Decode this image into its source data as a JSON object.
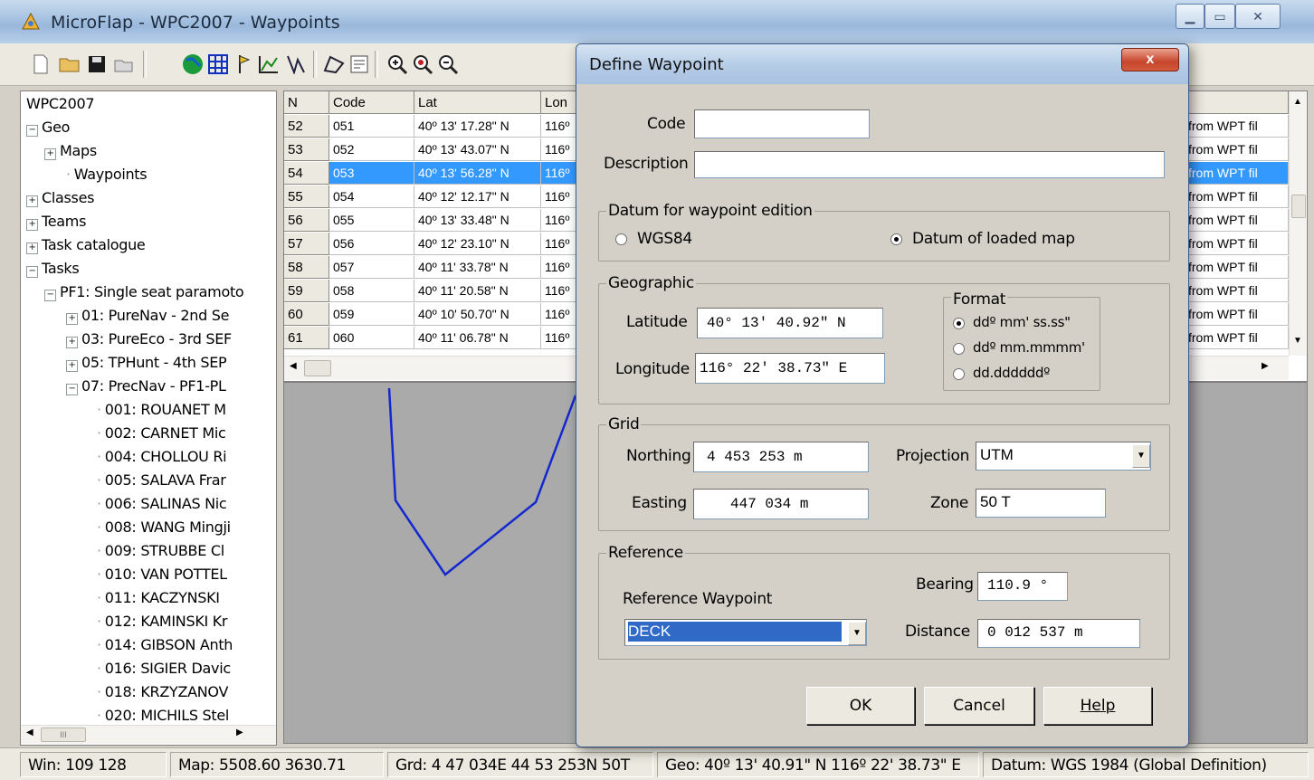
{
  "window": {
    "title": "MicroFlap - WPC2007 - Waypoints"
  },
  "tree": {
    "items": [
      {
        "label": "WPC2007",
        "level": 0,
        "expander": ""
      },
      {
        "label": "Geo",
        "level": 0,
        "expander": "−"
      },
      {
        "label": "Maps",
        "level": 1,
        "expander": "+"
      },
      {
        "label": "Waypoints",
        "level": 2,
        "expander": ""
      },
      {
        "label": "Classes",
        "level": 0,
        "expander": "+"
      },
      {
        "label": "Teams",
        "level": 0,
        "expander": "+"
      },
      {
        "label": "Task catalogue",
        "level": 0,
        "expander": "+"
      },
      {
        "label": "Tasks",
        "level": 0,
        "expander": "−"
      },
      {
        "label": "PF1: Single seat paramoto",
        "level": 1,
        "expander": "−"
      },
      {
        "label": "01: PureNav - 2nd Se",
        "level": 2,
        "expander": "+"
      },
      {
        "label": "03: PureEco - 3rd SEF",
        "level": 2,
        "expander": "+"
      },
      {
        "label": "05: TPHunt - 4th SEP",
        "level": 2,
        "expander": "+"
      },
      {
        "label": "07: PrecNav - PF1-PL",
        "level": 2,
        "expander": "−"
      },
      {
        "label": "001: ROUANET M",
        "level": 3,
        "expander": ""
      },
      {
        "label": "002: CARNET Mic",
        "level": 3,
        "expander": ""
      },
      {
        "label": "004: CHOLLOU Ri",
        "level": 3,
        "expander": ""
      },
      {
        "label": "005: SALAVA Frar",
        "level": 3,
        "expander": ""
      },
      {
        "label": "006: SALINAS Nic",
        "level": 3,
        "expander": ""
      },
      {
        "label": "008: WANG Mingji",
        "level": 3,
        "expander": ""
      },
      {
        "label": "009: STRUBBE Cl",
        "level": 3,
        "expander": ""
      },
      {
        "label": "010: VAN POTTEL",
        "level": 3,
        "expander": ""
      },
      {
        "label": "011: KACZYNSKI",
        "level": 3,
        "expander": ""
      },
      {
        "label": "012: KAMINSKI Kr",
        "level": 3,
        "expander": ""
      },
      {
        "label": "014: GIBSON Anth",
        "level": 3,
        "expander": ""
      },
      {
        "label": "016: SIGIER Davic",
        "level": 3,
        "expander": ""
      },
      {
        "label": "018: KRZYZANOV",
        "level": 3,
        "expander": ""
      },
      {
        "label": "020: MICHILS Stel",
        "level": 3,
        "expander": ""
      }
    ],
    "hscroll_grip": "III"
  },
  "grid": {
    "headers": [
      "N",
      "Code",
      "Lat",
      "Lon"
    ],
    "rows": [
      {
        "n": "52",
        "code": "051",
        "lat": "40º 13' 17.28\" N",
        "lon": "116º",
        "desc": "from WPT fil"
      },
      {
        "n": "53",
        "code": "052",
        "lat": "40º 13' 43.07\" N",
        "lon": "116º",
        "desc": "from WPT fil"
      },
      {
        "n": "54",
        "code": "053",
        "lat": "40º 13' 56.28\" N",
        "lon": "116º",
        "desc": "from WPT fil"
      },
      {
        "n": "55",
        "code": "054",
        "lat": "40º 12' 12.17\" N",
        "lon": "116º",
        "desc": "from WPT fil"
      },
      {
        "n": "56",
        "code": "055",
        "lat": "40º 13' 33.48\" N",
        "lon": "116º",
        "desc": "from WPT fil"
      },
      {
        "n": "57",
        "code": "056",
        "lat": "40º 12' 23.10\" N",
        "lon": "116º",
        "desc": "from WPT fil"
      },
      {
        "n": "58",
        "code": "057",
        "lat": "40º 11' 33.78\" N",
        "lon": "116º",
        "desc": "from WPT fil"
      },
      {
        "n": "59",
        "code": "058",
        "lat": "40º 11' 20.58\" N",
        "lon": "116º",
        "desc": "from WPT fil"
      },
      {
        "n": "60",
        "code": "059",
        "lat": "40º 10' 50.70\" N",
        "lon": "116º",
        "desc": "from WPT fil"
      },
      {
        "n": "61",
        "code": "060",
        "lat": "40º 11' 06.78\" N",
        "lon": "116º",
        "desc": "from WPT fil"
      }
    ],
    "selected_row": 2
  },
  "status": {
    "win": "Win: 109 128",
    "map": "Map: 5508.60 3630.71",
    "grd": "Grd: 4 47 034E 44 53 253N 50T",
    "geo": "Geo: 40º 13' 40.91\" N 116º 22' 38.73\" E",
    "datum": "Datum: WGS 1984 (Global Definition)"
  },
  "dialog": {
    "title": "Define Waypoint",
    "close": "x",
    "code_label": "Code",
    "code_value": "",
    "description_label": "Description",
    "description_value": "",
    "datum_group": "Datum for waypoint edition",
    "datum_wgs84": "WGS84",
    "datum_loaded": "Datum of loaded map",
    "datum_selected": "loaded",
    "geo_group": "Geographic",
    "latitude_label": "Latitude",
    "latitude_value": "40° 13' 40.92\" N",
    "longitude_label": "Longitude",
    "longitude_value": "116° 22' 38.73\" E",
    "format_group": "Format",
    "format_options": [
      "ddº mm' ss.ss\"",
      "ddº mm.mmmm'",
      "dd.ddddddº"
    ],
    "format_selected": 0,
    "grid_group": "Grid",
    "northing_label": "Northing",
    "northing_value": "4 453 253 m",
    "easting_label": "Easting",
    "easting_value": "447 034 m",
    "projection_label": "Projection",
    "projection_value": "UTM",
    "zone_label": "Zone",
    "zone_value": "50 T",
    "reference_group": "Reference",
    "ref_waypoint_label": "Reference Waypoint",
    "ref_waypoint_value": "DECK",
    "bearing_label": "Bearing",
    "bearing_value": "110.9 °",
    "distance_label": "Distance",
    "distance_value": "0 012 537 m",
    "ok": "OK",
    "cancel": "Cancel",
    "help": "Help"
  },
  "colors": {
    "selection": "#3399ff",
    "track": "#1428d0",
    "map_bg": "#aaaaaa"
  }
}
